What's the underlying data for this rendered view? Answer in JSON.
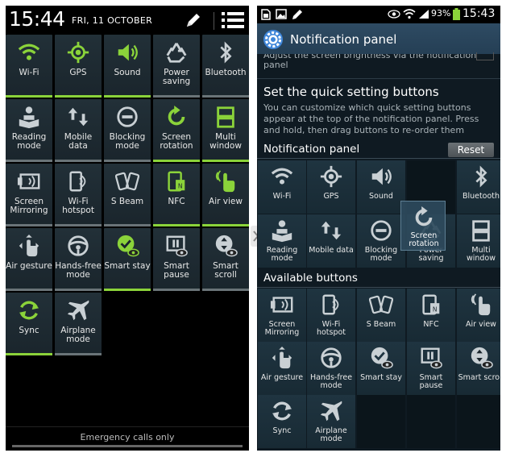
{
  "left": {
    "clock": "15:44",
    "date": "FRI, 11 OCTOBER",
    "tiles": [
      {
        "label": "Wi-Fi",
        "icon": "wifi-icon",
        "on": true
      },
      {
        "label": "GPS",
        "icon": "gps-icon",
        "on": true
      },
      {
        "label": "Sound",
        "icon": "sound-icon",
        "on": true
      },
      {
        "label": "Power saving",
        "icon": "recycle-icon",
        "on": false
      },
      {
        "label": "Bluetooth",
        "icon": "bluetooth-icon",
        "on": false
      },
      {
        "label": "Reading mode",
        "icon": "reading-icon",
        "on": false
      },
      {
        "label": "Mobile data",
        "icon": "mobile-data-icon",
        "on": false
      },
      {
        "label": "Blocking mode",
        "icon": "blocking-icon",
        "on": false
      },
      {
        "label": "Screen rotation",
        "icon": "rotation-icon",
        "on": true
      },
      {
        "label": "Multi window",
        "icon": "multi-window-icon",
        "on": true
      },
      {
        "label": "Screen Mirroring",
        "icon": "mirroring-icon",
        "on": false
      },
      {
        "label": "Wi-Fi hotspot",
        "icon": "hotspot-icon",
        "on": false
      },
      {
        "label": "S Beam",
        "icon": "sbeam-icon",
        "on": false
      },
      {
        "label": "NFC",
        "icon": "nfc-icon",
        "on": true
      },
      {
        "label": "Air view",
        "icon": "air-view-icon",
        "on": true
      },
      {
        "label": "Air gesture",
        "icon": "air-gesture-icon",
        "on": false
      },
      {
        "label": "Hands-free mode",
        "icon": "steering-wheel-icon",
        "on": false
      },
      {
        "label": "Smart stay",
        "icon": "smart-stay-icon",
        "on": true
      },
      {
        "label": "Smart pause",
        "icon": "smart-pause-icon",
        "on": false
      },
      {
        "label": "Smart scroll",
        "icon": "smart-scroll-icon",
        "on": false
      },
      {
        "label": "Sync",
        "icon": "sync-icon",
        "on": true
      },
      {
        "label": "Airplane mode",
        "icon": "airplane-icon",
        "on": false
      }
    ],
    "footer": "Emergency calls only"
  },
  "right": {
    "status": {
      "battery": "93%",
      "clock": "15:43"
    },
    "header_title": "Notification panel",
    "cutoff_text": "Adjust the screen brightness via the notification panel",
    "section_title": "Set the quick setting buttons",
    "section_desc": "You can customize which quick setting buttons appear at the top of the notification panel. Press and hold, then drag buttons to re-order them",
    "panel_label": "Notification panel",
    "reset_label": "Reset",
    "panel_tiles": [
      {
        "label": "Wi-Fi",
        "icon": "wifi-icon"
      },
      {
        "label": "GPS",
        "icon": "gps-icon"
      },
      {
        "label": "Sound",
        "icon": "sound-icon"
      },
      {
        "label": "",
        "icon": "",
        "slot": true
      },
      {
        "label": "Bluetooth",
        "icon": "bluetooth-icon"
      },
      {
        "label": "Reading mode",
        "icon": "reading-icon"
      },
      {
        "label": "Mobile data",
        "icon": "mobile-data-icon"
      },
      {
        "label": "Blocking mode",
        "icon": "blocking-icon"
      },
      {
        "label": "Power saving",
        "icon": "recycle-icon"
      },
      {
        "label": "Multi window",
        "icon": "multi-window-icon"
      }
    ],
    "dragging": {
      "label": "Screen rotation",
      "icon": "rotation-icon"
    },
    "available_label": "Available buttons",
    "available_tiles": [
      {
        "label": "Screen Mirroring",
        "icon": "mirroring-icon"
      },
      {
        "label": "Wi-Fi hotspot",
        "icon": "hotspot-icon"
      },
      {
        "label": "S Beam",
        "icon": "sbeam-icon"
      },
      {
        "label": "NFC",
        "icon": "nfc-icon"
      },
      {
        "label": "Air view",
        "icon": "air-view-icon"
      },
      {
        "label": "Air gesture",
        "icon": "air-gesture-icon"
      },
      {
        "label": "Hands-free mode",
        "icon": "steering-wheel-icon"
      },
      {
        "label": "Smart stay",
        "icon": "smart-stay-icon"
      },
      {
        "label": "Smart pause",
        "icon": "smart-pause-icon"
      },
      {
        "label": "Smart scroll",
        "icon": "smart-scroll-icon"
      },
      {
        "label": "Sync",
        "icon": "sync-icon"
      },
      {
        "label": "Airplane mode",
        "icon": "airplane-icon"
      }
    ]
  },
  "colors": {
    "active_green": "#8bd33a",
    "inactive_bar": "#6a7478",
    "icon_grey": "#c9d0d4",
    "header_blue": "#2e4b63"
  }
}
